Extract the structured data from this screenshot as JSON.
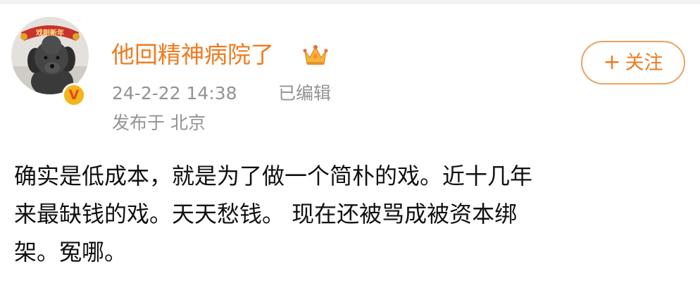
{
  "user": {
    "name": "他回精神病院了",
    "avatar_banner_text": "戏剧新年",
    "crown_icon": "crown-icon",
    "verified_icon": "verified-v-icon",
    "verified_mark": "V"
  },
  "meta": {
    "timestamp": "24-2-22 14:38",
    "edited": "已编辑",
    "location": "发布于 北京"
  },
  "follow_button": {
    "icon": "+",
    "label": "关注"
  },
  "post": {
    "lines": [
      "确实是低成本，就是为了做一个简朴的戏。近十几年",
      "来最缺钱的戏。天天愁钱。 现在还被骂成被资本绑",
      "架。冤哪。"
    ]
  },
  "colors": {
    "username": "#ee7b20",
    "meta_text": "#939393",
    "follow_border": "#eaa260",
    "verified_badge": "#f2b51a"
  }
}
